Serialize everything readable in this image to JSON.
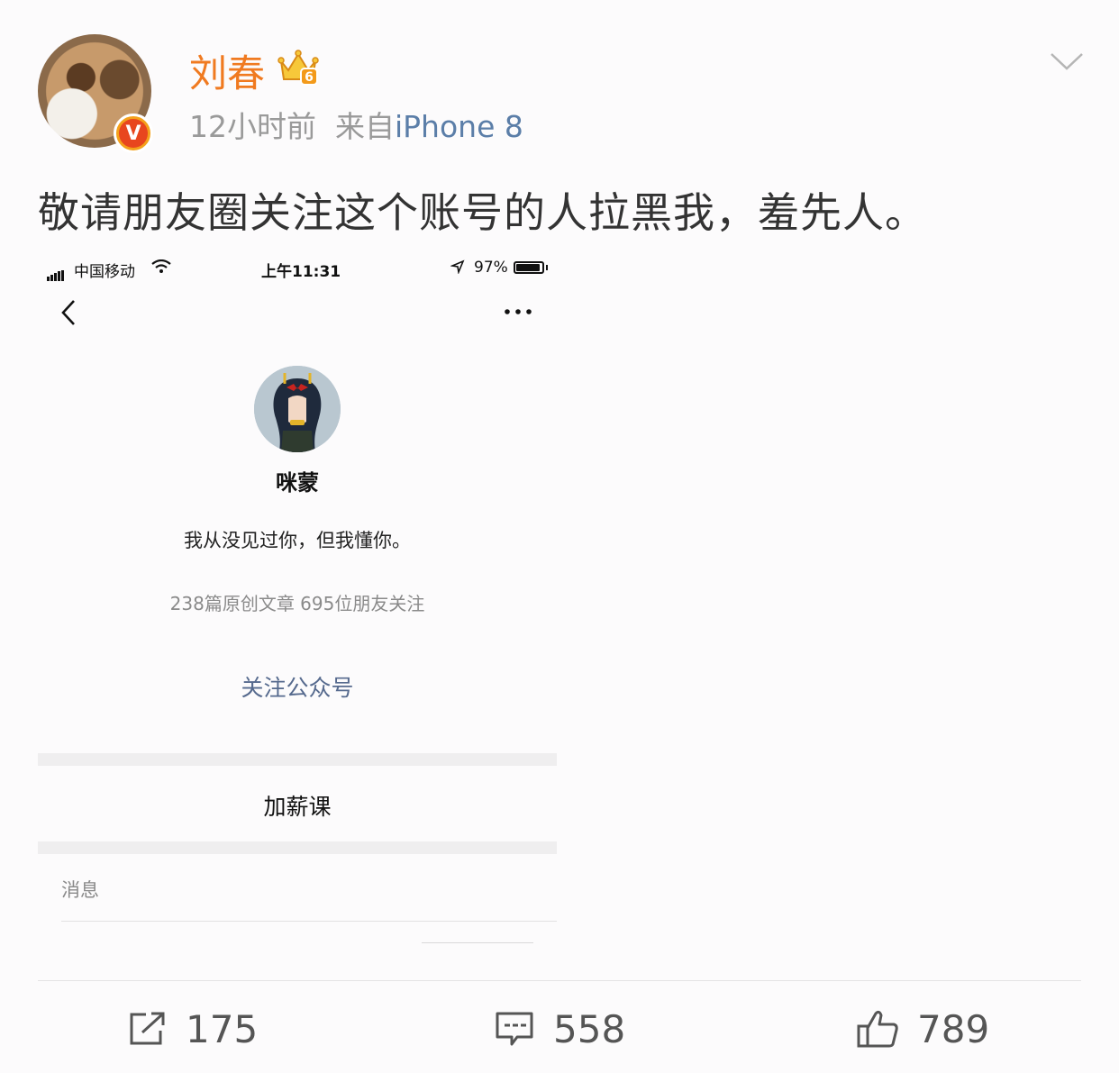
{
  "post": {
    "author_name": "刘春",
    "verified_badge": "V",
    "level_badge": "6",
    "timestamp": "12小时前",
    "source_prefix": "来自",
    "source_device": "iPhone 8",
    "text": "敬请朋友圈关注这个账号的人拉黑我，羞先人。"
  },
  "embedded": {
    "status_bar": {
      "carrier": "中国移动",
      "time": "上午11:31",
      "battery": "97%"
    },
    "account_name": "咪蒙",
    "bio": "我从没见过你，但我懂你。",
    "stats": "238篇原创文章  695位朋友关注",
    "follow_label": "关注公众号",
    "menu_item": "加薪课",
    "messages_label": "消息"
  },
  "actions": {
    "repost_count": "175",
    "comment_count": "558",
    "like_count": "789"
  },
  "icons": {
    "repost": "share-icon",
    "comment": "comment-icon",
    "like": "thumbs-up-icon",
    "menu": "chevron-down-icon"
  },
  "colors": {
    "username": "#f07a20",
    "source_link": "#5b7ea8",
    "follow_link": "#566a8e"
  }
}
